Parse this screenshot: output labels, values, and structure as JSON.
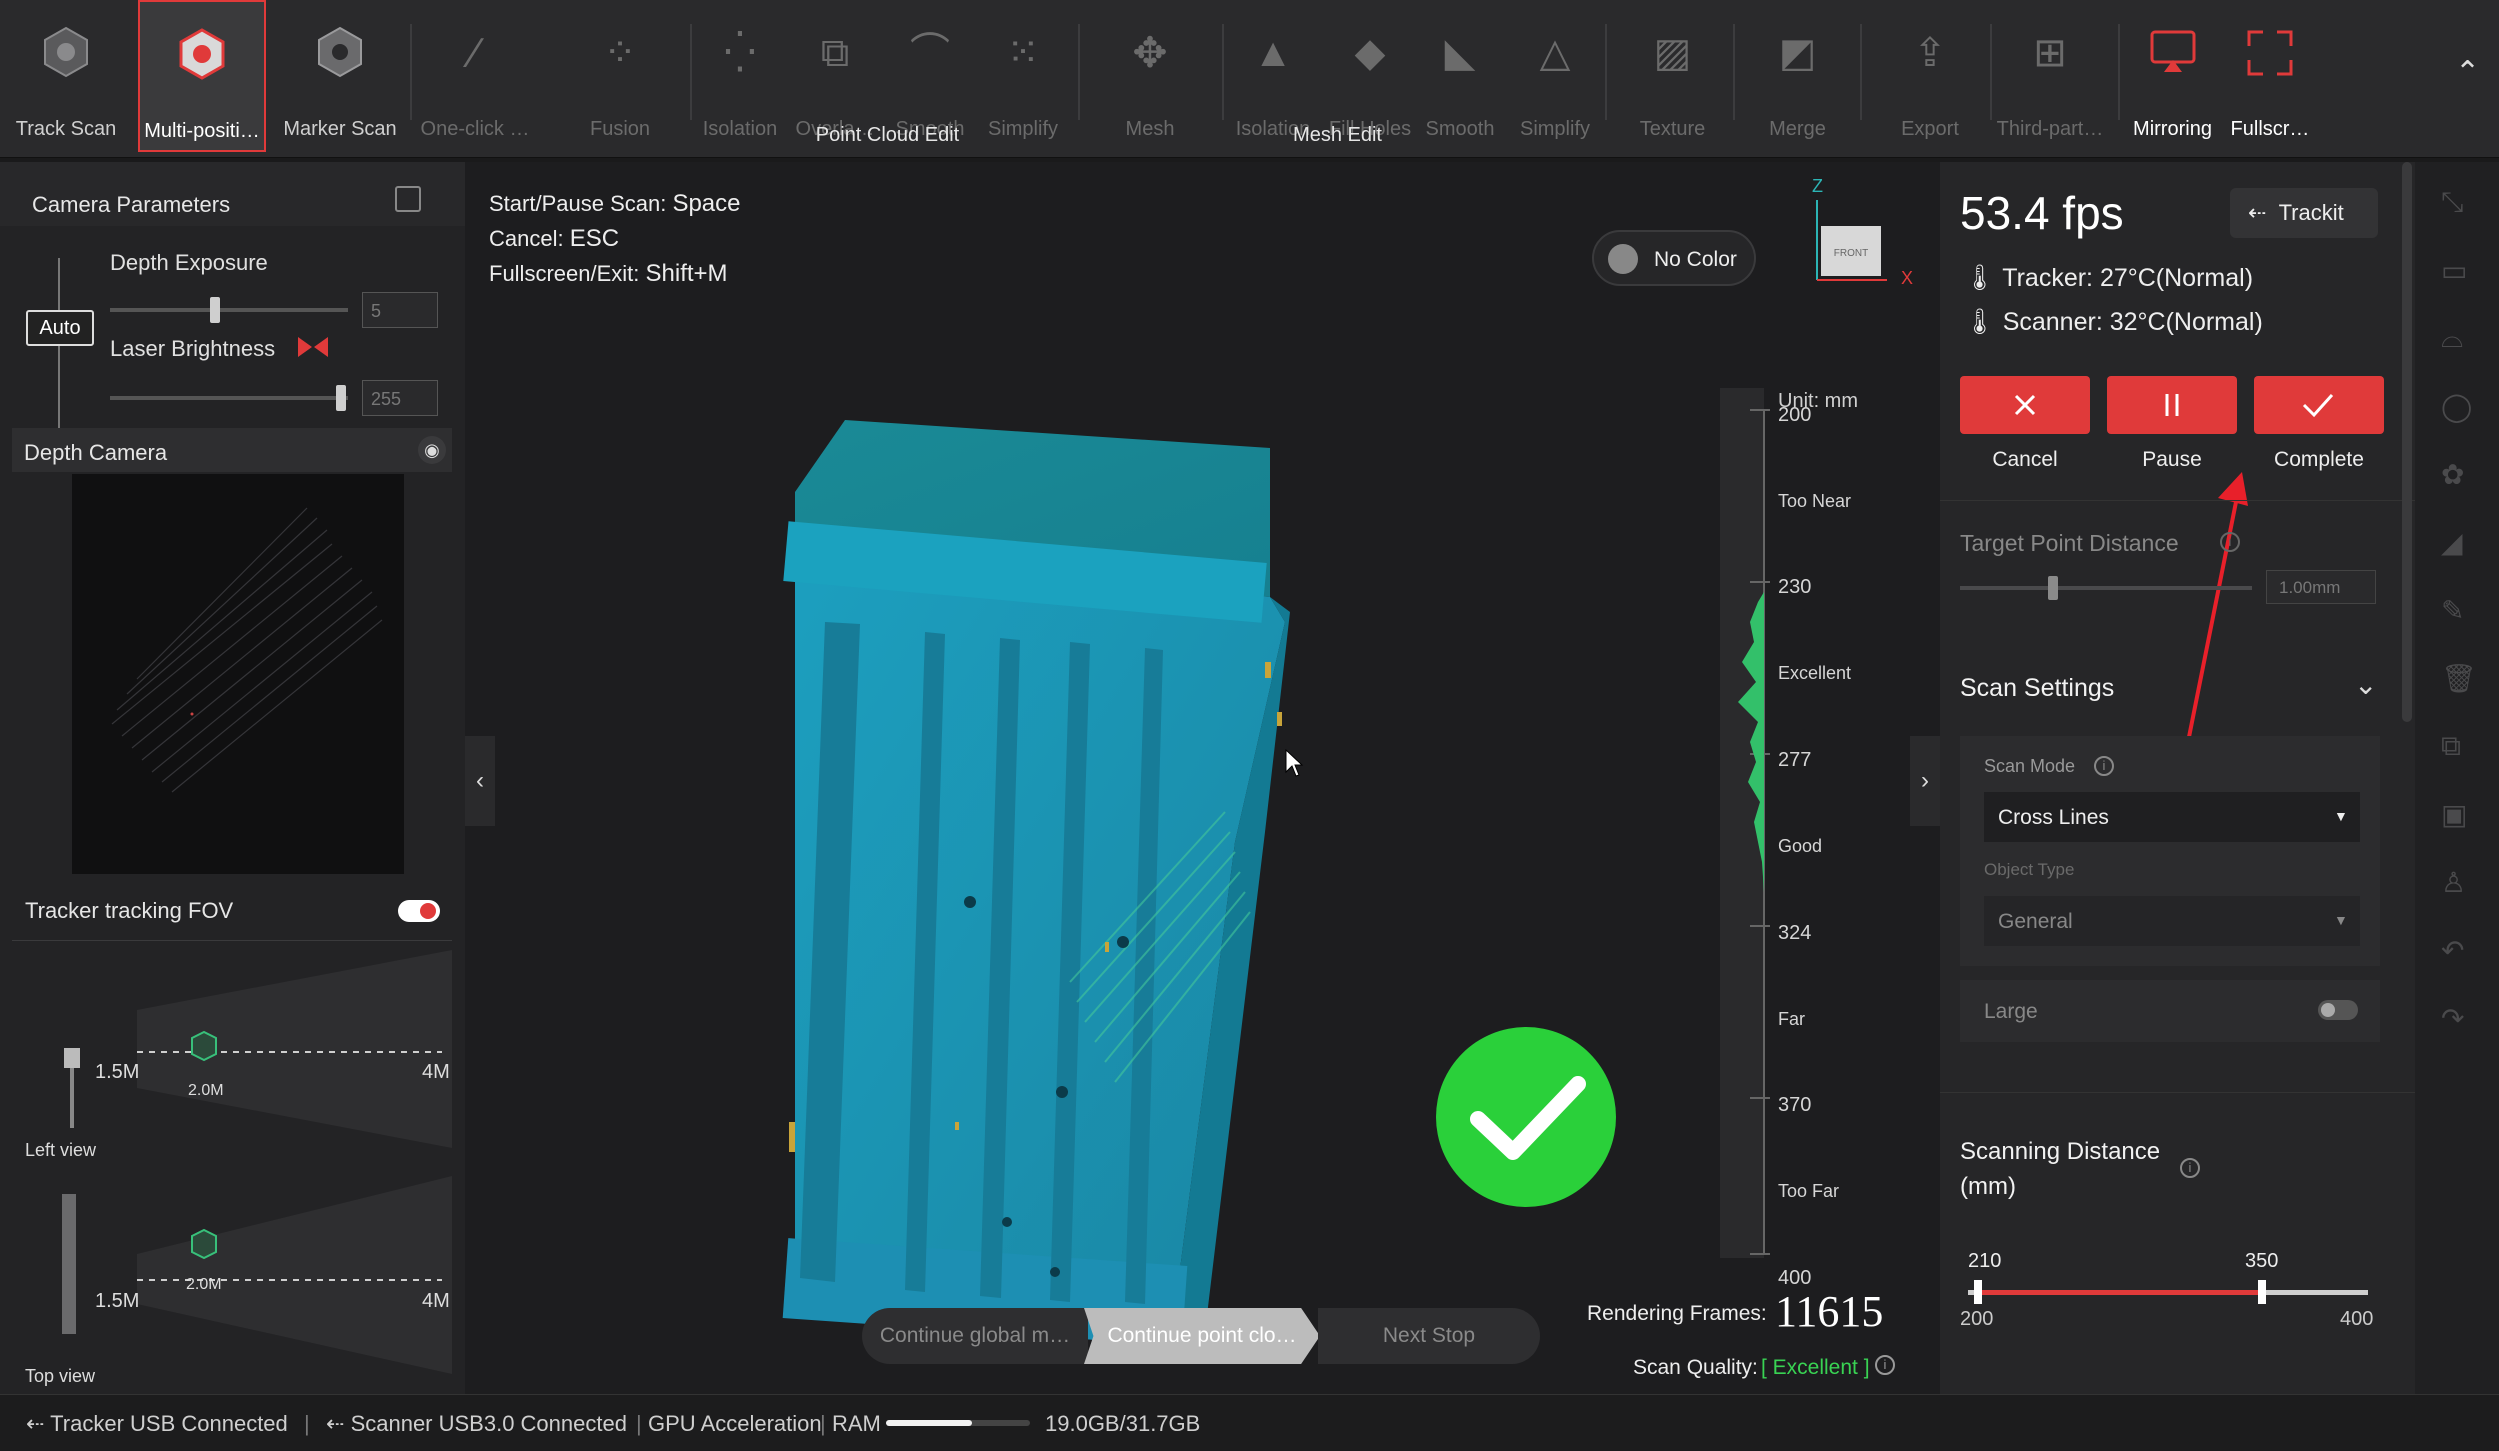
{
  "toolbar": {
    "modes": [
      {
        "label": "Track Scan",
        "icon": "track-scan-icon"
      },
      {
        "label": "Multi-positi…",
        "icon": "multi-position-icon"
      },
      {
        "label": "Marker Scan",
        "icon": "marker-scan-icon"
      }
    ],
    "tools": [
      {
        "label": "One-click …",
        "icon": "wand-icon"
      },
      {
        "label": "Fusion",
        "icon": "fusion-icon"
      },
      {
        "label": "Isolation",
        "icon": "isolation-icon"
      },
      {
        "label": "Overla…",
        "icon": "overlap-icon"
      },
      {
        "label": "Smooth",
        "icon": "smooth-icon"
      },
      {
        "label": "Simplify",
        "icon": "simplify-icon"
      },
      {
        "label": "Mesh",
        "icon": "mesh-icon"
      },
      {
        "label": "Isolation",
        "icon": "isolation-icon"
      },
      {
        "label": "Fill Holes",
        "icon": "fill-holes-icon"
      },
      {
        "label": "Smooth",
        "icon": "smooth-icon"
      },
      {
        "label": "Simplify",
        "icon": "simplify-icon"
      },
      {
        "label": "Texture",
        "icon": "texture-icon"
      },
      {
        "label": "Merge",
        "icon": "merge-icon"
      },
      {
        "label": "Export",
        "icon": "export-icon"
      },
      {
        "label": "Third-part…",
        "icon": "third-party-icon"
      },
      {
        "label": "Mirroring",
        "icon": "mirroring-icon"
      },
      {
        "label": "Fullscr…",
        "icon": "fullscreen-icon"
      }
    ],
    "groups": {
      "point_cloud": "Point Cloud Edit",
      "mesh": "Mesh Edit"
    }
  },
  "left": {
    "camera_parameters": "Camera Parameters",
    "depth_exposure": "Depth Exposure",
    "depth_exposure_value": "5",
    "auto": "Auto",
    "laser_brightness": "Laser Brightness",
    "laser_brightness_value": "255",
    "depth_camera": "Depth Camera",
    "tracker_fov": "Tracker tracking FOV",
    "left_view": "Left view",
    "top_view": "Top view",
    "fov_near": "1.5M",
    "fov_mid": "2.0M",
    "fov_far": "4M"
  },
  "viewport": {
    "shortcuts": [
      {
        "key": "Start/Pause Scan:",
        "value": "Space"
      },
      {
        "key": "Cancel:",
        "value": "ESC"
      },
      {
        "key": "Fullscreen/Exit:",
        "value": "Shift+M"
      }
    ],
    "no_color": "No Color",
    "axis_z": "Z",
    "axis_x": "X",
    "cube_front": "FRONT",
    "unit": "Unit: mm",
    "scale": [
      "200",
      "Too Near",
      "230",
      "Excellent",
      "277",
      "Good",
      "324",
      "Far",
      "370",
      "Too Far",
      "400"
    ],
    "steps": [
      "Continue global m…",
      "Continue point clo…",
      "Next Stop"
    ],
    "rendering_label": "Rendering Frames:",
    "rendering_value": "11615",
    "scan_quality_label": "Scan Quality:",
    "scan_quality_value": "[ Excellent ]"
  },
  "right": {
    "fps": "53.4 fps",
    "trackit": "Trackit",
    "tracker_temp": "Tracker: 27°C(Normal)",
    "scanner_temp": "Scanner: 32°C(Normal)",
    "cancel": "Cancel",
    "pause": "Pause",
    "complete": "Complete",
    "target_point_distance": "Target Point Distance",
    "target_value": "1.00mm",
    "scan_settings": "Scan Settings",
    "scan_mode_label": "Scan Mode",
    "scan_mode_value": "Cross Lines",
    "object_type_label": "Object Type",
    "object_type_value": "General",
    "large": "Large",
    "scanning_distance": "Scanning Distance (mm)",
    "range_low": "210",
    "range_high": "350",
    "range_min": "200",
    "range_max": "400"
  },
  "status": {
    "tracker": "Tracker USB Connected",
    "scanner": "Scanner USB3.0 Connected",
    "gpu": "GPU Acceleration",
    "ram": "RAM",
    "ram_value": "19.0GB/31.7GB",
    "ram_fraction": 0.6
  },
  "colors": {
    "accent_red": "#e03a3a",
    "excellent_green": "#39d353",
    "point_cloud_teal": "#1a8fa8"
  }
}
